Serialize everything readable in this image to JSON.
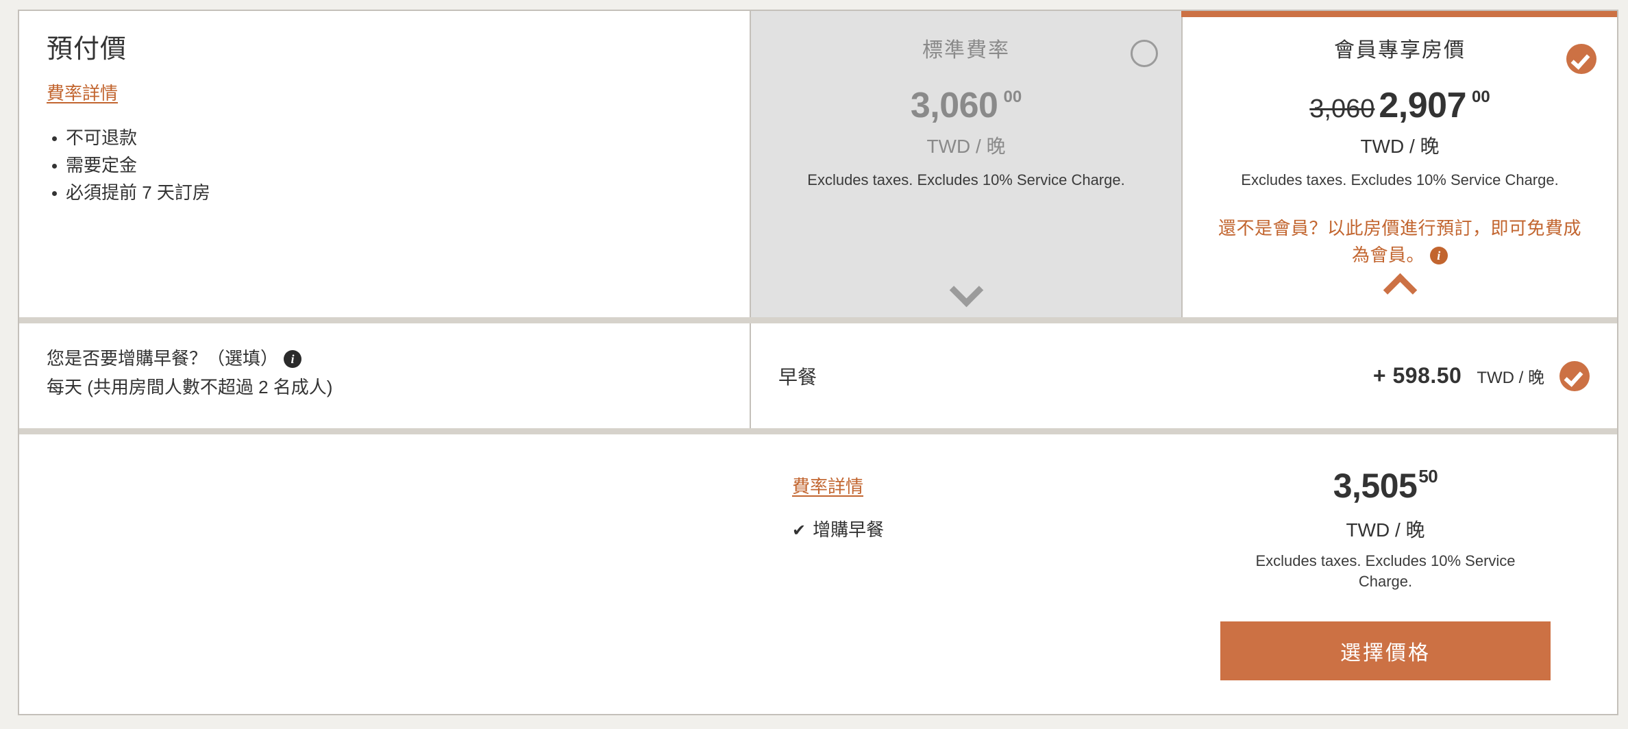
{
  "terms": {
    "title": "預付價",
    "rate_details_link": "費率詳情",
    "bullets": [
      "不可退款",
      "需要定金",
      "必須提前 7 天訂房"
    ]
  },
  "standard_rate": {
    "heading": "標準費率",
    "price": "3,060",
    "cents": "00",
    "currency": "TWD / 晚",
    "tax_note": "Excludes taxes. Excludes 10% Service Charge.",
    "selected": false,
    "radio_icon": "radio-unselected-icon",
    "expand_icon": "chevron-down-icon"
  },
  "member_rate": {
    "heading": "會員專享房價",
    "strike_price": "3,060",
    "price": "2,907",
    "cents": "00",
    "currency": "TWD / 晚",
    "tax_note": "Excludes taxes. Excludes 10% Service Charge.",
    "promo_text": "還不是會員？以此房價進行預訂，即可免費成為會員。",
    "promo_info_icon": "info-icon",
    "selected": true,
    "check_icon": "check-circle-icon",
    "collapse_icon": "chevron-up-icon"
  },
  "breakfast": {
    "question": "您是否要增購早餐？（選填）",
    "question_info_icon": "info-icon",
    "subtext": "每天 (共用房間人數不超過 2 名成人)",
    "option_label": "早餐",
    "amount": "+ 598.50",
    "currency": "TWD / 晚",
    "selected": true,
    "check_icon": "check-circle-icon"
  },
  "summary": {
    "rate_details_link": "費率詳情",
    "included_items": [
      {
        "tick": "✔",
        "label": "增購早餐"
      }
    ],
    "total_amount": "3,505",
    "total_cents": "50",
    "total_currency": "TWD / 晚",
    "total_tax_note": "Excludes taxes. Excludes 10% Service Charge.",
    "select_button_label": "選擇價格"
  },
  "colors": {
    "accent_orange": "#cc7144",
    "link_orange": "#c2652f",
    "page_background": "#f1f0ec",
    "standard_column_background": "#e1e1e1",
    "border_grey": "#c4c0ba",
    "separator_grey": "#d6d2cb",
    "muted_text": "#8a8a8a"
  }
}
